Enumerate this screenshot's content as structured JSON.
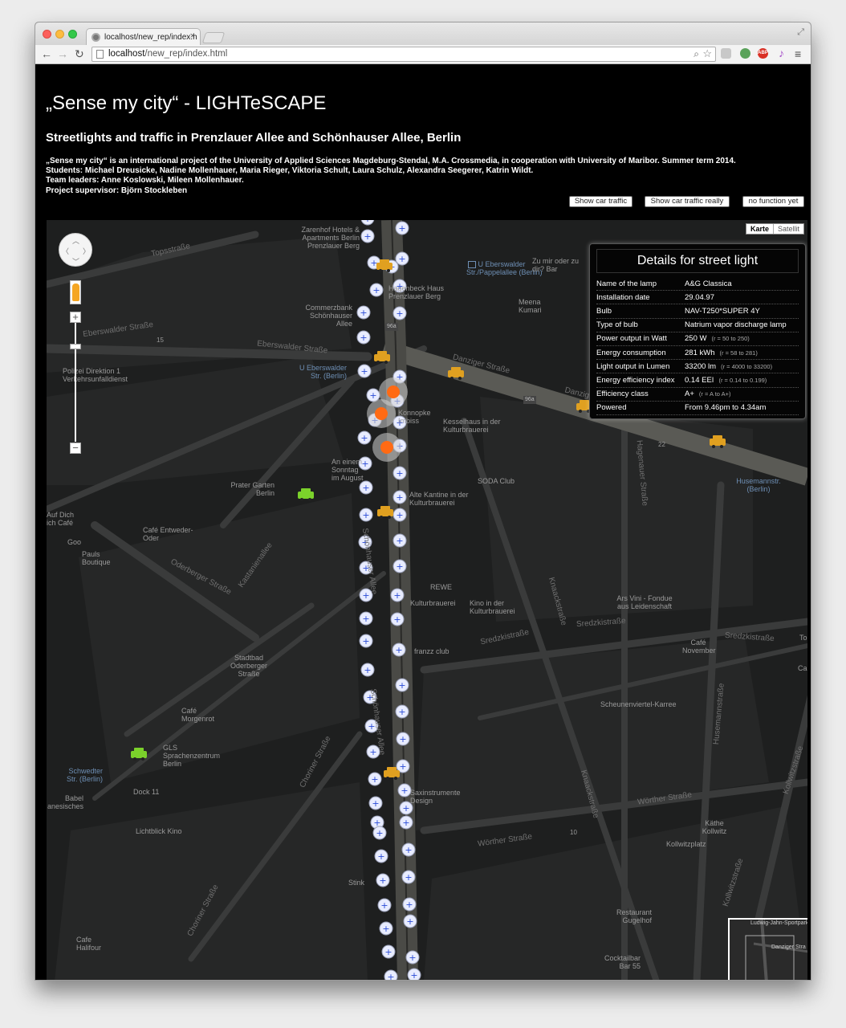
{
  "browser": {
    "tab_title": "localhost/new_rep/index.h",
    "url_host": "localhost",
    "url_path": "/new_rep/index.html"
  },
  "page": {
    "title": "„Sense my city“ - LIGHTeSCAPE",
    "subtitle": "Streetlights and traffic in Prenzlauer Allee and Schönhauser Allee, Berlin",
    "intro_lines": [
      "„Sense my city“ is an international project of the University of Applied Sciences Magdeburg-Stendal, M.A. Crossmedia, in cooperation with University of Maribor. Summer term 2014.",
      "Students: Michael Dreusicke, Nadine Mollenhauer, Maria Rieger, Viktoria Schult, Laura Schulz, Alexandra Seegerer, Katrin Wildt.",
      "Team leaders: Anne Koslowski, Mileen Mollenhauer.",
      "Project supervisor: Björn Stockleben"
    ],
    "buttons": {
      "show_traffic": "Show car traffic",
      "show_traffic_really": "Show car traffic really",
      "no_function": "no function yet"
    }
  },
  "map": {
    "maptype": {
      "map": "Karte",
      "satellite": "Satellit"
    },
    "zoom_in": "+",
    "zoom_out": "−",
    "labels": [
      "Topsstraße",
      "Zarenhof Hotels & Apartments Berlin Prenzlauer Berg",
      "U Eberswalder Str./Pappelallee (Berlin)",
      "Zu mir oder zu dir? Bar",
      "Meena Kumari",
      "Hagenbeck Haus Prenzlauer Berg",
      "Commerzbank Schönhauser Allee",
      "Eberswalder Straße",
      "Eberswalder Straße",
      "U Eberswalder Str. (Berlin)",
      "Polizei Direktion 1 Verkehrsunfalldienst",
      "Danziger Straße",
      "Danziger",
      "Kesselhaus in der Kulturbrauerei",
      "Konnopke Imbiss",
      "An einem Sonntag im August",
      "SODA Club",
      "Prater Garten Berlin",
      "Alte Kantine in der Kulturbrauerei",
      "Auf Dich ich Café",
      "Café Entweder-Oder",
      "Goo",
      "Pauls Boutique",
      "Oderberger Straße",
      "Kastanienallee",
      "REWE",
      "Kulturbrauerei",
      "Kino in der Kulturbrauerei",
      "Knaackstraße",
      "Ars Vini - Fondue aus Leidenschaft",
      "Sredzkistraße",
      "Sredzkistraße",
      "Sredzkistraße",
      "franzz club",
      "Stadtbad Oderberger Straße",
      "Café November",
      "Café Morgenrot",
      "GLS Sprachenzentrum Berlin",
      "Scheunenviertel-Karree",
      "Schwedter Str. (Berlin)",
      "Dock 11",
      "Babel anesisches",
      "Husemannstraße",
      "Husemannstr. (Berlin)",
      "Hagenauer Straße",
      "Saxinstrumente Design",
      "Wörther Straße",
      "Wörther Straße",
      "Käthe Kollwitz",
      "Kollwitzplatz",
      "Lichtblick Kino",
      "Stink",
      "Restaurant Gugelhof",
      "Cocktailbar Bar 55",
      "Cafe Halifour",
      "Choriner Straße",
      "Choriner Straße",
      "Schönhauser Allee",
      "Schönhauser Allee",
      "Kollwitzstraße",
      "Kollwitzstraße",
      "Knaackstraße",
      "96a",
      "96a",
      "22",
      "10",
      "15",
      "Ca",
      "To",
      "Ludwig-Jahn-Sportpark",
      "Danziger Stra"
    ]
  },
  "details": {
    "title": "Details for street light",
    "rows": [
      {
        "key": "Name of the lamp",
        "value": "A&G Classica",
        "range": ""
      },
      {
        "key": "Installation date",
        "value": "29.04.97",
        "range": ""
      },
      {
        "key": "Bulb",
        "value": "NAV-T250*SUPER 4Y",
        "range": ""
      },
      {
        "key": "Type of bulb",
        "value": "Natrium vapor discharge lamp",
        "range": ""
      },
      {
        "key": "Power output in Watt",
        "value": "250 W",
        "range": "(r = 50 to 250)"
      },
      {
        "key": "Energy consumption",
        "value": "281 kWh",
        "range": "(r = 58 to 281)"
      },
      {
        "key": "Light output in Lumen",
        "value": "33200 lm",
        "range": "(r = 4000 to 33200)"
      },
      {
        "key": "Energy efficiency index",
        "value": "0.14 EEI",
        "range": "(r = 0.14 to 0.199)"
      },
      {
        "key": "Efficiency class",
        "value": "A+",
        "range": "(r = A to A+)"
      },
      {
        "key": "Powered",
        "value": "From 9.46pm to 4.34am",
        "range": ""
      }
    ]
  },
  "colors": {
    "map_bg": "#1e1f1f",
    "street": "#3a3b3b",
    "main_road": "#5a5a55",
    "lamp_marker": "#e8ecff",
    "lamp_cross": "#2a4bd6",
    "active_lamp": "#ff6a14",
    "car_yellow": "#e0a020",
    "car_green": "#7bd12b"
  }
}
